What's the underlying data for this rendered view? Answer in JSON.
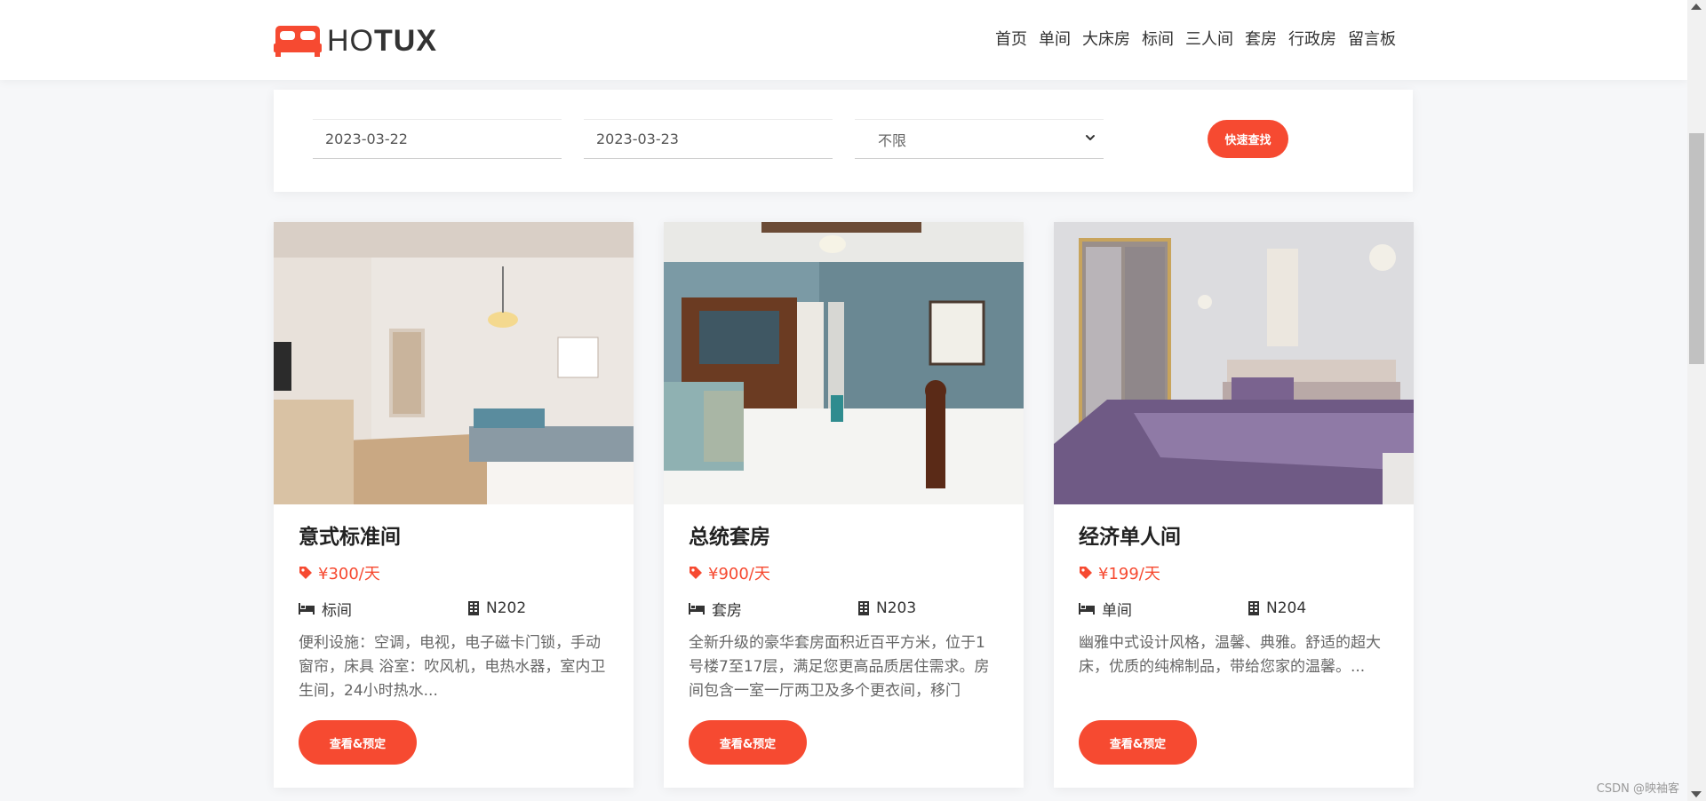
{
  "header": {
    "logo_light": "HO",
    "logo_bold": "TUX",
    "nav": [
      "首页",
      "单间",
      "大床房",
      "标间",
      "三人间",
      "套房",
      "行政房",
      "留言板"
    ]
  },
  "search": {
    "checkin": "2023-03-22",
    "checkout": "2023-03-23",
    "room_type": "不限",
    "button": "快速查找"
  },
  "rooms": [
    {
      "title": "意式标准间",
      "price": "¥300/天",
      "type": "标间",
      "room_no": "N202",
      "desc": "便利设施：空调，电视，电子磁卡门锁，手动窗帘，床具 浴室：吹风机，电热水器，室内卫生间，24小时热水...",
      "button": "查看&预定"
    },
    {
      "title": "总统套房",
      "price": "¥900/天",
      "type": "套房",
      "room_no": "N203",
      "desc": "全新升级的豪华套房面积近百平方米，位于1号楼7至17层，满足您更高品质居住需求。房间包含一室一厅两卫及多个更衣间，移门",
      "button": "查看&预定"
    },
    {
      "title": "经济单人间",
      "price": "¥199/天",
      "type": "单间",
      "room_no": "N204",
      "desc": "幽雅中式设计风格，温馨、典雅。舒适的超大床，优质的纯棉制品，带给您家的温馨。...",
      "button": "查看&预定"
    }
  ],
  "watermark": "CSDN @映袖客",
  "colors": {
    "accent": "#f64a31"
  },
  "icons": {
    "logo": "bed-icon",
    "price": "tag-icon",
    "type": "bed-icon",
    "room_no": "building-icon",
    "select": "chevron-down-icon"
  }
}
